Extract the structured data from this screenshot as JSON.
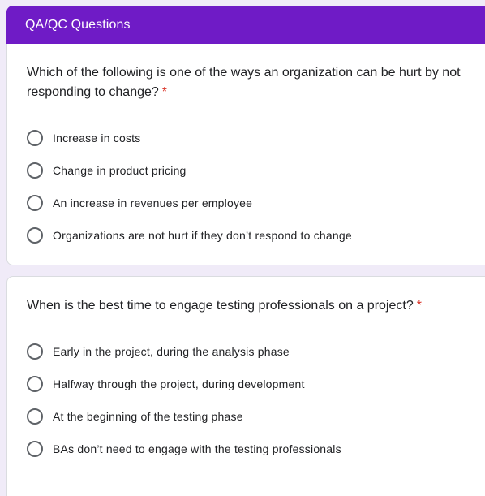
{
  "section": {
    "title": "QA/QC Questions"
  },
  "questions": [
    {
      "title": "Which of the following is one of the ways an organization can be hurt by not responding to change?",
      "required_mark": "*",
      "options": [
        "Increase in costs",
        "Change in product pricing",
        "An increase in revenues per employee",
        "Organizations are not hurt if they don’t respond to change"
      ]
    },
    {
      "title": "When is the best time to engage testing professionals on a project?",
      "required_mark": "*",
      "options": [
        "Early in the project, during the analysis phase",
        "Halfway through the project, during development",
        "At the beginning of the testing phase",
        "BAs don’t need to engage with the testing professionals"
      ]
    }
  ],
  "colors": {
    "header_bg": "#6f1bc6",
    "page_bg": "#f0ebf8",
    "required": "#d93025",
    "radio_border": "#5f6368"
  }
}
